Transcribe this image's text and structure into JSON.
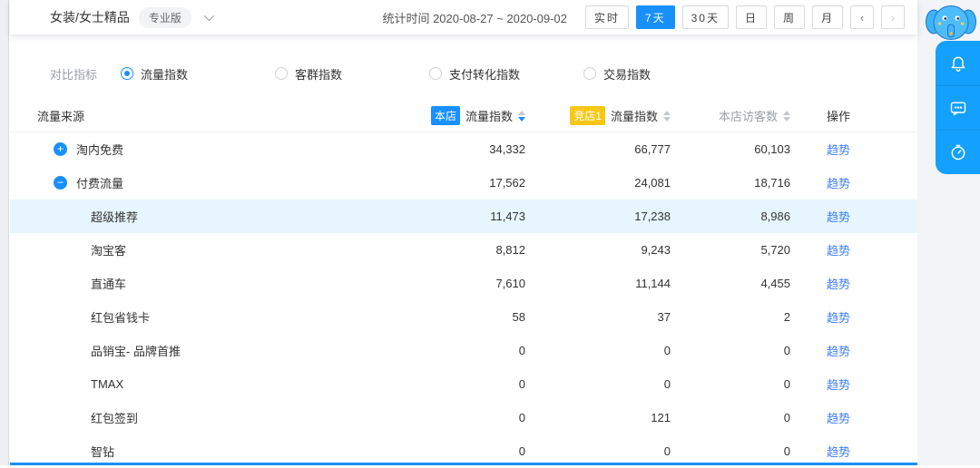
{
  "topbar": {
    "category": "女装/女士精品",
    "badge": "专业版",
    "stat_time_label": "统计时间",
    "date_range": "2020-08-27 ~ 2020-09-02",
    "range_buttons": [
      {
        "label": "实时",
        "active": false
      },
      {
        "label": "7天",
        "active": true
      },
      {
        "label": "30天",
        "active": false
      },
      {
        "label": "日",
        "active": false
      },
      {
        "label": "周",
        "active": false
      },
      {
        "label": "月",
        "active": false
      }
    ],
    "prev": "‹",
    "next": "›"
  },
  "filters": {
    "label": "对比指标",
    "options": [
      {
        "label": "流量指数",
        "selected": true
      },
      {
        "label": "客群指数",
        "selected": false
      },
      {
        "label": "支付转化指数",
        "selected": false
      },
      {
        "label": "交易指数",
        "selected": false
      }
    ]
  },
  "table": {
    "columns": {
      "source": "流量来源",
      "own_badge": "本店",
      "own_metric": "流量指数",
      "rival_badge": "竞店1",
      "rival_metric": "流量指数",
      "visitors": "本店访客数",
      "action": "操作"
    },
    "action_label": "趋势",
    "rows": [
      {
        "name": "淘内免费",
        "level": 0,
        "expand": "plus",
        "own": "34,332",
        "rival": "66,777",
        "visitors": "60,103"
      },
      {
        "name": "付费流量",
        "level": 0,
        "expand": "minus",
        "own": "17,562",
        "rival": "24,081",
        "visitors": "18,716"
      },
      {
        "name": "超级推荐",
        "level": 1,
        "highlight": true,
        "own": "11,473",
        "rival": "17,238",
        "visitors": "8,986"
      },
      {
        "name": "淘宝客",
        "level": 1,
        "own": "8,812",
        "rival": "9,243",
        "visitors": "5,720"
      },
      {
        "name": "直通车",
        "level": 1,
        "own": "7,610",
        "rival": "11,144",
        "visitors": "4,455"
      },
      {
        "name": "红包省钱卡",
        "level": 1,
        "own": "58",
        "rival": "37",
        "visitors": "2"
      },
      {
        "name": "品销宝- 品牌首推",
        "level": 1,
        "own": "0",
        "rival": "0",
        "visitors": "0"
      },
      {
        "name": "TMAX",
        "level": 1,
        "own": "0",
        "rival": "0",
        "visitors": "0"
      },
      {
        "name": "红包签到",
        "level": 1,
        "own": "0",
        "rival": "121",
        "visitors": "0"
      },
      {
        "name": "智钻",
        "level": 1,
        "own": "0",
        "rival": "0",
        "visitors": "0"
      }
    ]
  },
  "side_toolbar": {
    "icons": [
      "bell-icon",
      "chat-icon",
      "timer-icon"
    ]
  },
  "colors": {
    "accent_blue": "#1890ff",
    "rival_badge_yellow": "#f9c716",
    "highlight_row": "#e7f6fe",
    "panel_blue": "#14a1fe",
    "link_blue": "#3d7eff"
  }
}
